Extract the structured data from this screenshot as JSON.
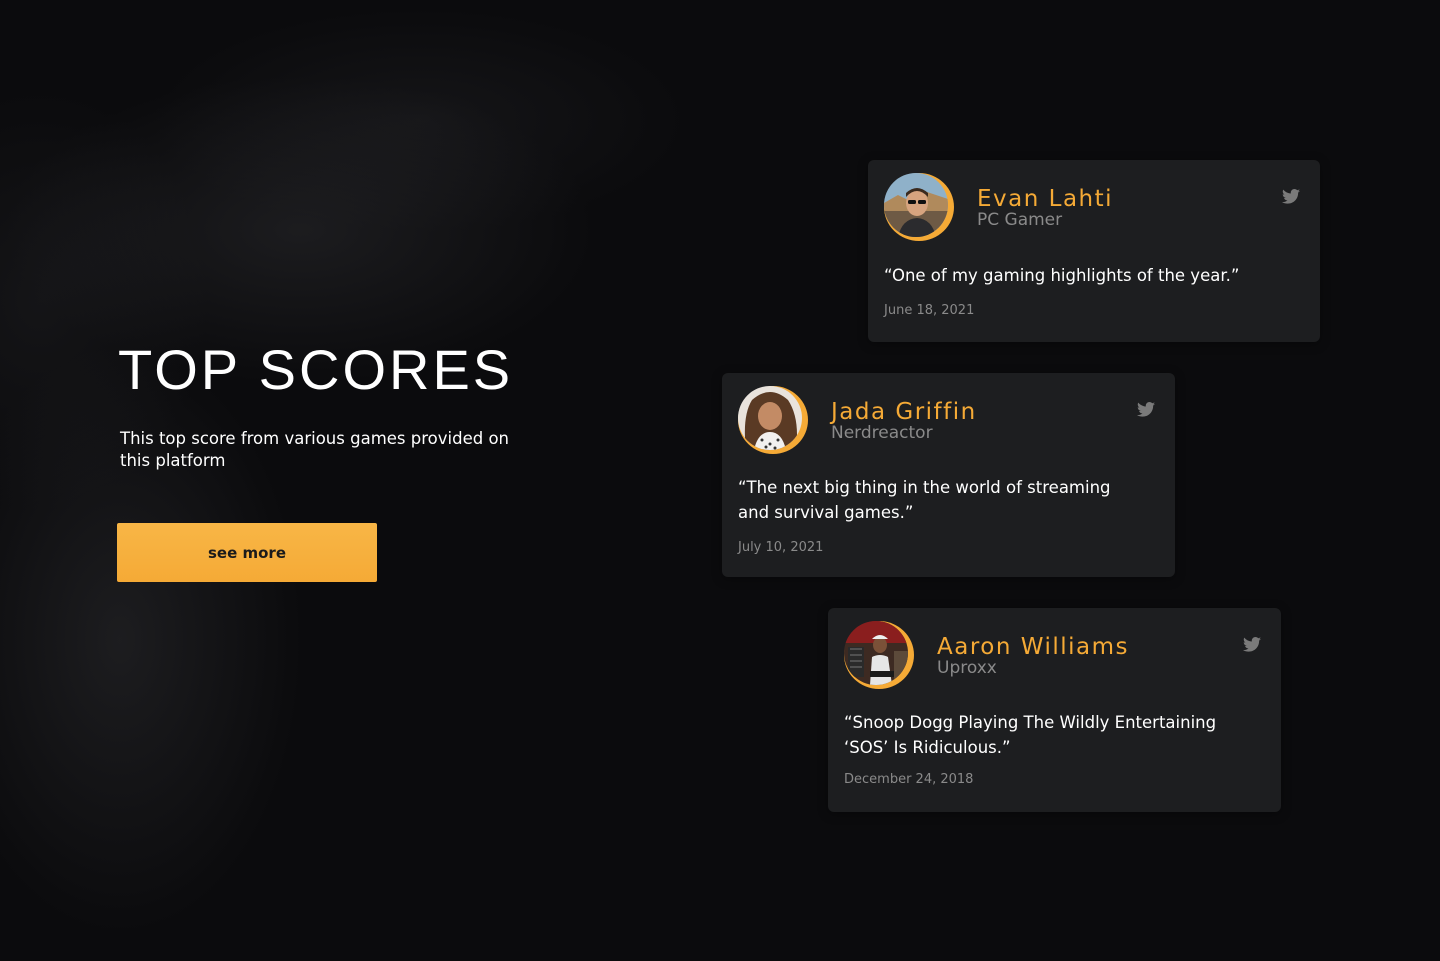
{
  "hero": {
    "title": "TOP SCORES",
    "description": "This top score from various games provided on this platform",
    "button_label": "see more"
  },
  "colors": {
    "background": "#0b0b0d",
    "card": "#1d1e20",
    "accent": "#f5aa36",
    "muted_text": "#8a8a8a",
    "text": "#ffffff"
  },
  "reviews": [
    {
      "name": "Evan Lahti",
      "outlet": "PC Gamer",
      "quote": "“One of my gaming highlights of the year.”",
      "date": "June 18, 2021",
      "avatar_icon": "avatar-photo",
      "social_icon": "twitter-icon"
    },
    {
      "name": "Jada Griffin",
      "outlet": "Nerdreactor",
      "quote": "“The next big thing in the world of streaming and survival games.”",
      "date": "July 10, 2021",
      "avatar_icon": "avatar-photo",
      "social_icon": "twitter-icon"
    },
    {
      "name": "Aaron Williams",
      "outlet": "Uproxx",
      "quote": "“Snoop Dogg Playing The Wildly Entertaining ‘SOS’ Is Ridiculous.”",
      "date": "December 24, 2018",
      "avatar_icon": "avatar-photo",
      "social_icon": "twitter-icon"
    }
  ]
}
